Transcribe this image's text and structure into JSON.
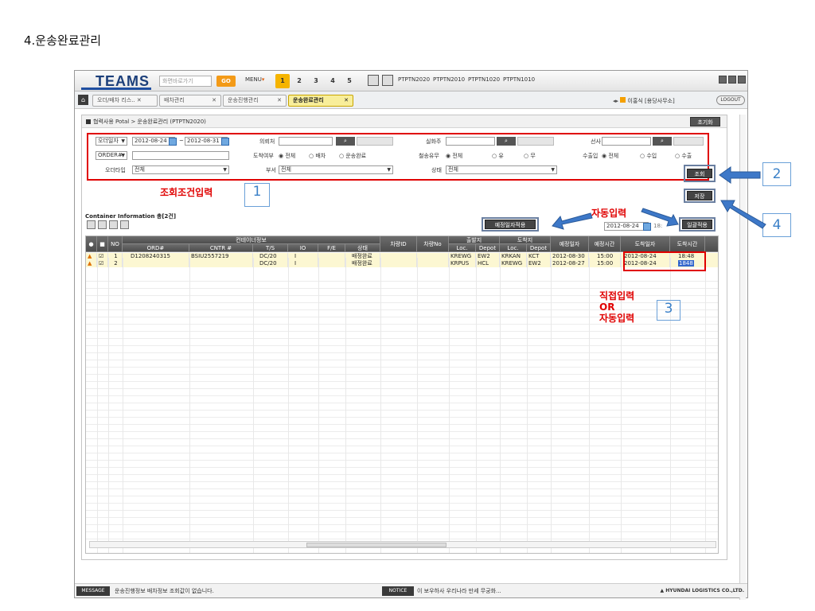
{
  "doc_title": "4.운송완료관리",
  "topbar": {
    "logo": "TEAMS",
    "search_placeholder": "화면바로가기",
    "go": "GO",
    "menu": "MENU",
    "tabs": [
      "1",
      "2",
      "3",
      "4",
      "5"
    ],
    "codes": [
      "PTPTN2020",
      "PTPTN2010",
      "PTPTN1020",
      "PTPTN1010"
    ]
  },
  "doc_tabs": [
    "오더/배차 리스..",
    "배차관리",
    "운송진행관리",
    "운송완료관리"
  ],
  "user": "이홍식 [용당사무소]",
  "logout": "LOGOUT",
  "breadcrumb": "협력사용 Potal > 운송완료관리 (PTPTN2020)",
  "init_btn": "초기화",
  "filters": {
    "order_date_label": "오더일자",
    "date_from": "2012-08-24",
    "tilde": "~",
    "date_to": "2012-08-31",
    "order_no_label": "ORDER#",
    "order_type_label": "오더타입",
    "order_type_value": "전체",
    "client_label": "의뢰처",
    "arrival_label": "도착여부",
    "arrival_options": [
      "전체",
      "배차",
      "운송완료"
    ],
    "dept_label": "부서",
    "dept_value": "전체",
    "shipper_label": "실화주",
    "container_label": "철송유무",
    "container_options": [
      "전체",
      "유",
      "무"
    ],
    "status_label": "상태",
    "status_value": "전체",
    "carrier_label": "선사",
    "io_label": "수출입",
    "io_options": [
      "전체",
      "수입",
      "수출"
    ]
  },
  "buttons": {
    "search": "조회",
    "save": "저장",
    "apply_expected": "예정일자적용",
    "bulk_apply": "일괄적용"
  },
  "annotations": {
    "filter_input": "조회조건입력",
    "auto_input": "자동입력",
    "direct_input_1": "직접입력",
    "direct_input_2": "OR",
    "direct_input_3": "자동입력",
    "box1": "1",
    "box2": "2",
    "box3": "3",
    "box4": "4"
  },
  "bulk_date": "2012-08-24",
  "bulk_time": "18:",
  "section_title": "Container Information 총[2건]",
  "grid": {
    "group_headers": {
      "container_info": "컨테이너정보",
      "origin": "출발지",
      "dest": "도착지"
    },
    "headers": [
      "●",
      "■",
      "NO",
      "ORD#",
      "CNTR #",
      "T/S",
      "IO",
      "F/E",
      "상태",
      "차량ID",
      "차량No",
      "Loc.",
      "Depot",
      "Loc.",
      "Depot",
      "예정일자",
      "예정시간",
      "도착일자",
      "도착시간"
    ],
    "rows": [
      {
        "no": "1",
        "ord": "D1208240315",
        "cntr": "BSIU2557219",
        "ts": "DC/20",
        "io": "I",
        "fe": "",
        "status": "배정완료",
        "veh_id": "",
        "veh_no": "",
        "o_loc": "KREWG",
        "o_depot": "EW2",
        "d_loc": "KRKAN",
        "d_depot": "KCT",
        "plan_date": "2012-08-30",
        "plan_time": "15:00",
        "arr_date": "2012-08-24",
        "arr_time": "18:48"
      },
      {
        "no": "2",
        "ord": "",
        "cntr": "",
        "ts": "DC/20",
        "io": "I",
        "fe": "",
        "status": "배정완료",
        "veh_id": "",
        "veh_no": "",
        "o_loc": "KRPUS",
        "o_depot": "HCL",
        "d_loc": "KREWG",
        "d_depot": "EW2",
        "plan_date": "2012-08-27",
        "plan_time": "15:00",
        "arr_date": "2012-08-24",
        "arr_time": "1848"
      }
    ]
  },
  "status_bar": {
    "message_label": "MESSAGE",
    "message": "운송진행정보 배차정보 조회값이 없습니다.",
    "notice_label": "NOTICE",
    "notice": "이 보우하사 우리나라 만세 무궁화...",
    "brand": "▲ HYUNDAI LOGISTICS CO.,LTD."
  }
}
